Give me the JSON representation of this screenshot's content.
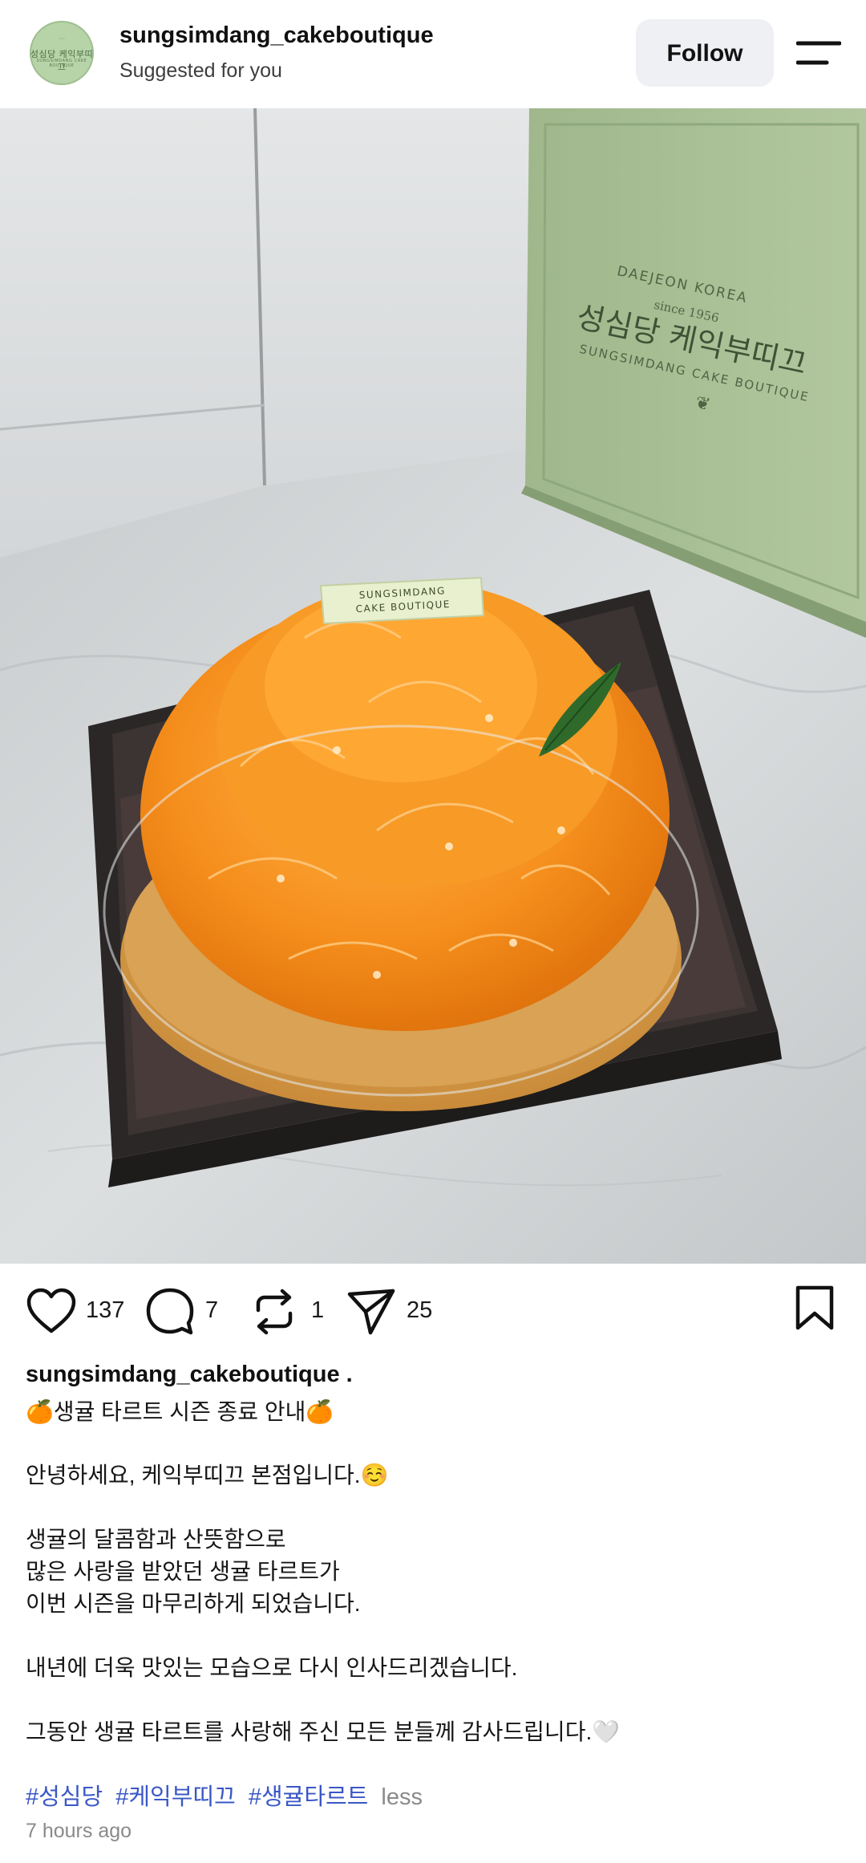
{
  "header": {
    "avatar_text": "성심당 케익부띠끄",
    "avatar_sub": "SUNGSIMDANG CAKE BOUTIQUE",
    "username": "sungsimdang_cakeboutique",
    "subtitle": "Suggested for you",
    "follow_label": "Follow"
  },
  "photo": {
    "box_text": {
      "line1": "DAEJEON KOREA",
      "line2": "since 1956",
      "line3": "성심당 케익부띠끄",
      "line4": "SUNGSIMDANG CAKE BOUTIQUE"
    },
    "tag_text": {
      "line1": "SUNGSIMDANG",
      "line2": "CAKE BOUTIQUE"
    }
  },
  "actions": {
    "likes": "137",
    "comments": "7",
    "reposts": "1",
    "shares": "25"
  },
  "caption": {
    "username": "sungsimdang_cakeboutique .",
    "lines": [
      "🍊생귤 타르트 시즌 종료 안내🍊",
      "안녕하세요, 케익부띠끄 본점입니다.☺️",
      "생귤의 달콤함과 산뜻함으로",
      "많은 사랑을 받았던 생귤 타르트가",
      "이번 시즌을 마무리하게 되었습니다.",
      "내년에 더욱 맛있는 모습으로 다시 인사드리겠습니다.",
      "그동안 생귤 타르트를 사랑해 주신 모든 분들께 감사드립니다.🤍"
    ],
    "hashtags": [
      "#성심당",
      "#케익부띠끄",
      "#생귤타르트"
    ],
    "less_label": "less",
    "time": "7 hours ago"
  },
  "colors": {
    "hashtag": "#3a57c6",
    "follow_bg": "#eef0f3",
    "box_green": "#a9c096",
    "orange": "#f08a1a"
  }
}
